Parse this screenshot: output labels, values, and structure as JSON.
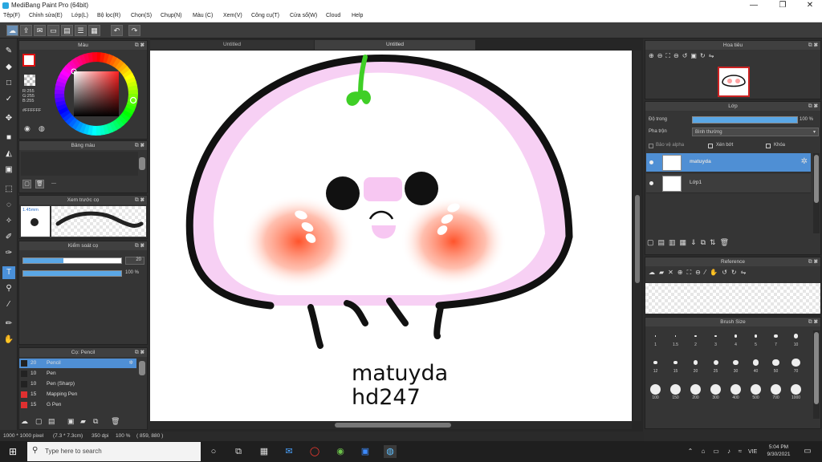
{
  "window": {
    "title": "MediBang Paint Pro (64bit)",
    "min": "—",
    "max": "❐",
    "close": "✕"
  },
  "menu": [
    "Tệp(F)",
    "Chỉnh sửa(E)",
    "Lớp(L)",
    "Bộ lọc(R)",
    "Chọn(S)",
    "Chụp(N)",
    "Màu (C)",
    "Xem(V)",
    "Công cụ(T)",
    "Cửa sổ(W)",
    "Cloud",
    "Help"
  ],
  "color_panel": {
    "title": "Màu",
    "r": "R:255",
    "g": "G:255",
    "b": "B:255",
    "hex": "#FFFFFF"
  },
  "palette_panel": {
    "title": "Bảng màu",
    "dash": "---"
  },
  "brush_preview": {
    "title": "Xem trước cọ",
    "size": "1.45mm"
  },
  "brush_control": {
    "title": "Kiểm soát cọ",
    "size_value": "20",
    "opacity_value": "100 %",
    "size_fraction": 0.41,
    "opacity_fraction": 1.0
  },
  "brush_list": {
    "title": "Cọ: Pencil",
    "items": [
      {
        "size": "20",
        "name": "Pencil",
        "color": "#222222",
        "selected": true
      },
      {
        "size": "10",
        "name": "Pen",
        "color": "#222222",
        "selected": false
      },
      {
        "size": "10",
        "name": "Pen (Sharp)",
        "color": "#222222",
        "selected": false
      },
      {
        "size": "15",
        "name": "Mapping Pen",
        "color": "#e03030",
        "selected": false
      },
      {
        "size": "15",
        "name": "G Pen",
        "color": "#e03030",
        "selected": false
      }
    ]
  },
  "canvas": {
    "tab1": "Untitled",
    "tab2": "Untitled",
    "caption_line1": "matuyda",
    "caption_line2": "hd247"
  },
  "navigator": {
    "title": "Hoa tiêu"
  },
  "layers": {
    "title": "Lớp",
    "opacity_label": "Độ trong",
    "opacity_value": "100 %",
    "opacity_fraction": 1.0,
    "blend_label": "Pha trộn",
    "blend_value": "Bình thường",
    "protect_alpha": "Bảo vệ alpha",
    "clipping": "Xén bớt",
    "lock": "Khóa",
    "items": [
      {
        "name": "matuyda",
        "selected": true
      },
      {
        "name": "Lớp1",
        "selected": false
      }
    ]
  },
  "reference": {
    "title": "Reference"
  },
  "brush_size": {
    "title": "Brush Size",
    "sizes": [
      "1",
      "1.5",
      "2",
      "3",
      "4",
      "5",
      "7",
      "10",
      "12",
      "15",
      "20",
      "25",
      "30",
      "40",
      "50",
      "70",
      "100",
      "150",
      "200",
      "300",
      "400",
      "500",
      "700",
      "1000"
    ]
  },
  "status": {
    "dimensions": "1000 * 1000 pixel",
    "physical": "(7.3 * 7.3cm)",
    "dpi": "350 dpi",
    "zoom": "100 %",
    "coords": "( 859, 880 )"
  },
  "taskbar": {
    "search_placeholder": "Type here to search",
    "time": "5:04 PM",
    "date": "9/30/2021",
    "lang": "VIE"
  },
  "colors": {
    "accent": "#5aa7e6",
    "panel": "#353535",
    "header": "#404040"
  }
}
